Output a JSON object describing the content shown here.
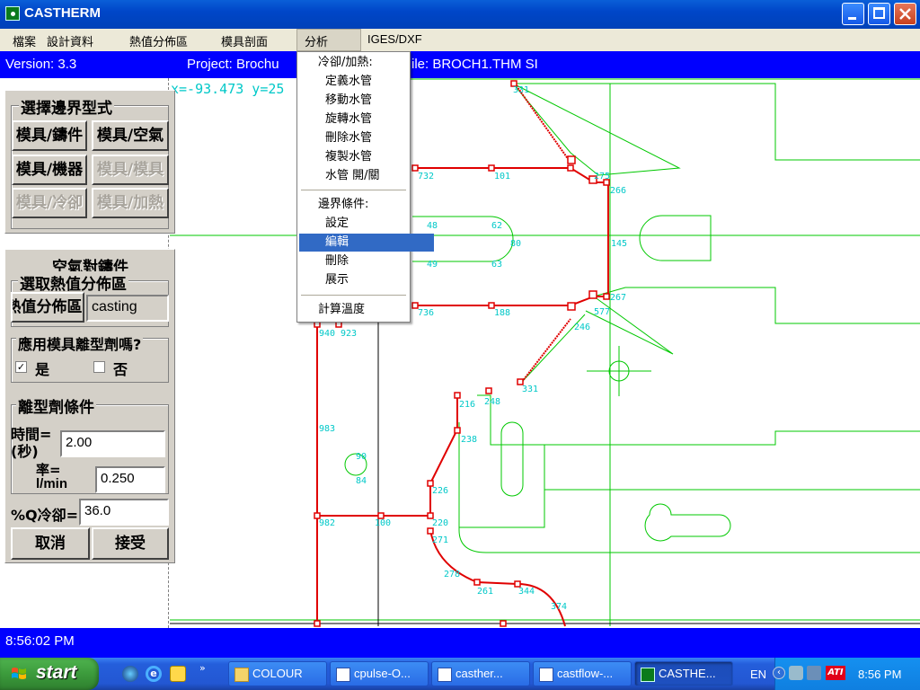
{
  "window": {
    "title": "CASTHERM"
  },
  "menubar": {
    "items": [
      "檔案",
      "設計資料",
      "熱值分佈區",
      "模具剖面",
      "分析",
      "IGES/DXF"
    ]
  },
  "infobar": {
    "version": "Version: 3.3",
    "project": "Project: Brochu",
    "file": "ile: BROCH1.THM SI"
  },
  "left_panel": {
    "boundary_type_title": "選擇邊界型式",
    "boundary_buttons": [
      {
        "label": "模具/鑄件",
        "enabled": true
      },
      {
        "label": "模具/空氣",
        "enabled": true
      },
      {
        "label": "模具/機器",
        "enabled": true
      },
      {
        "label": "模具/模具",
        "enabled": false
      },
      {
        "label": "模具/冷卻",
        "enabled": false
      },
      {
        "label": "模具/加熱",
        "enabled": false
      }
    ],
    "air_casting_title": "空氣對鑄件",
    "select_zone_title": "選取熱值分佈區",
    "zone_button": "熱值分佈區",
    "zone_value": "casting",
    "release_agent_question": "應用模具離型劑嗎?",
    "yes_label": "是",
    "no_label": "否",
    "yes_checked": true,
    "no_checked": false,
    "release_conditions_title": "離型劑條件",
    "time_label_1": "時間=",
    "time_label_2": "(秒)",
    "time_value": "2.00",
    "rate_label_1": "率=",
    "rate_label_2": "l/min",
    "rate_value": "0.250",
    "q_cool_label": "%Q冷卻=",
    "q_cool_value": "36.0",
    "cancel": "取消",
    "accept": "接受"
  },
  "canvas": {
    "coord_readout": "x=-93.473 y=25",
    "node_labels": [
      "732",
      "101",
      "48",
      "62",
      "80",
      "49",
      "63",
      "145",
      "736",
      "188",
      "275",
      "266",
      "267",
      "577",
      "246",
      "940",
      "923",
      "983",
      "90",
      "84",
      "216",
      "248",
      "238",
      "226",
      "220",
      "271",
      "278",
      "261",
      "344",
      "374",
      "100",
      "982",
      "331"
    ]
  },
  "dropdown": {
    "section1": "冷卻/加熱:",
    "items1": [
      "定義水管",
      "移動水管",
      "旋轉水管",
      "刪除水管",
      "複製水管",
      "水管 開/關"
    ],
    "section2": "邊界條件:",
    "items2": [
      "設定",
      "編輯",
      "刪除",
      "展示"
    ],
    "highlighted": "編輯",
    "calc": "計算溫度"
  },
  "statusbar": {
    "time": "8:56:02 PM"
  },
  "taskbar": {
    "start": "start",
    "tasks": [
      {
        "label": "COLOUR",
        "icon": "folder-icon"
      },
      {
        "label": "cpulse-O...",
        "icon": "word-doc-icon"
      },
      {
        "label": "casther...",
        "icon": "word-doc-icon"
      },
      {
        "label": "castflow-...",
        "icon": "word-doc-icon"
      },
      {
        "label": "CASTHE...",
        "icon": "castherm-app-icon"
      }
    ],
    "language": "EN",
    "clock": "8:56 PM"
  },
  "colors": {
    "mold": "#00c800",
    "cooling": "#e00000",
    "labels": "#00c8c8",
    "highlight": "#316ac5"
  }
}
